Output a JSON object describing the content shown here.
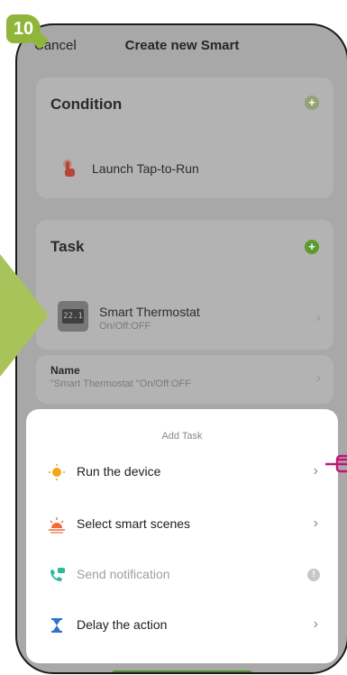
{
  "step": {
    "number": "10"
  },
  "header": {
    "cancel_label": "Cancel",
    "title": "Create new Smart"
  },
  "condition": {
    "title": "Condition",
    "item_label": "Launch Tap-to-Run"
  },
  "task": {
    "title": "Task",
    "device_name": "Smart Thermostat",
    "device_status": "On/Off:OFF",
    "device_display": "22.1"
  },
  "name_card": {
    "label": "Name",
    "value": "\"Smart Thermostat \"On/Off:OFF"
  },
  "add_task_sheet": {
    "title": "Add Task",
    "items": [
      {
        "label": "Run the device",
        "icon": "sun-icon"
      },
      {
        "label": "Select smart scenes",
        "icon": "sunset-icon"
      },
      {
        "label": "Send notification",
        "icon": "phone-message-icon"
      },
      {
        "label": "Delay the action",
        "icon": "hourglass-icon"
      }
    ]
  },
  "colors": {
    "accent_green": "#5e9b2e",
    "badge_green": "#8fb53a",
    "pointer_pink": "#c4147a"
  }
}
